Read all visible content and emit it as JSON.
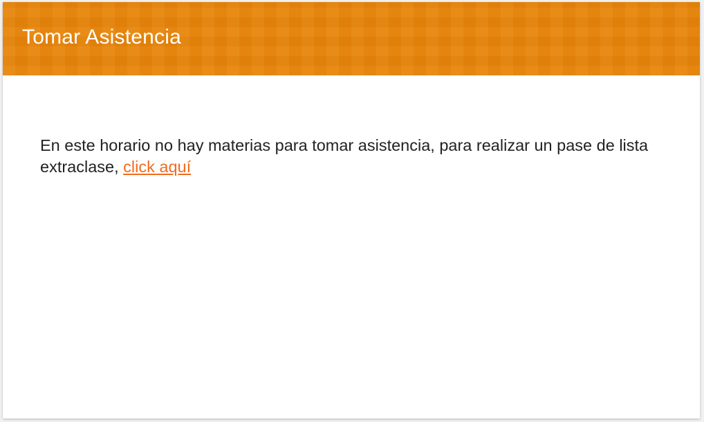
{
  "card": {
    "title": "Tomar Asistencia",
    "message_text": "En este horario no hay materias para tomar asistencia, para realizar un pase de lista extraclase, ",
    "link_label": "click aquí"
  },
  "colors": {
    "header_bg": "#e8850a",
    "link": "#f26a1b",
    "text": "#222222"
  }
}
